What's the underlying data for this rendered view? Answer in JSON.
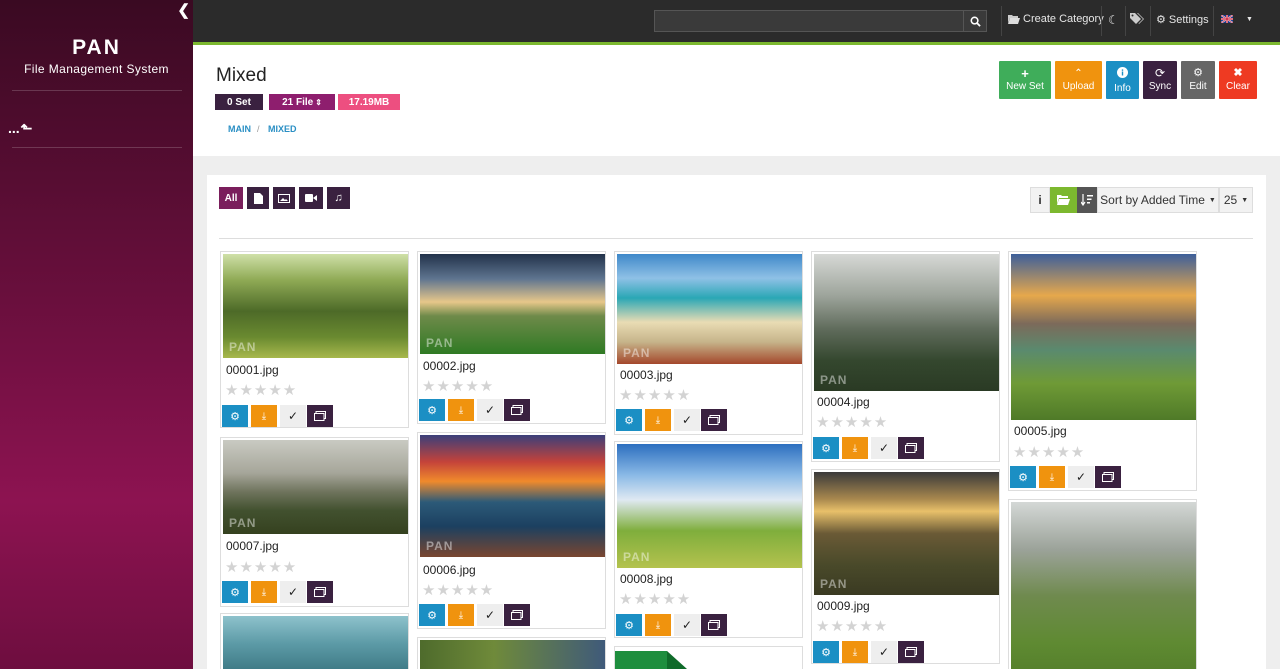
{
  "app": {
    "logo": "PAN",
    "subtitle": "File Management System",
    "up_label": "...",
    "watermark": "PAN"
  },
  "topbar": {
    "search_placeholder": "",
    "create_category": "Create Category",
    "settings": "Settings",
    "theme_icon": "moon-icon",
    "tags_icon": "tags-icon",
    "language_icon": "uk-flag-icon"
  },
  "header": {
    "title": "Mixed",
    "badges": {
      "sets": "0 Set",
      "files": "21 File",
      "size": "17.19MB"
    },
    "breadcrumb": [
      "MAIN",
      "MIXED"
    ],
    "actions": {
      "new_set": "New Set",
      "upload": "Upload",
      "info": "Info",
      "sync": "Sync",
      "edit": "Edit",
      "clear": "Clear"
    }
  },
  "colors": {
    "new_set": "#3fad5a",
    "upload": "#f0930e",
    "info": "#1b8fc4",
    "sync": "#3a2140",
    "edit": "#666666",
    "clear": "#ee3a22",
    "accent": "#7cb82f",
    "badge_sets": "#3a2140",
    "badge_files": "#8e1e6e",
    "badge_size": "#ed4f80"
  },
  "toolbar": {
    "filters": [
      "All",
      "document-icon",
      "image-icon",
      "video-icon",
      "music-icon"
    ],
    "sort_label": "Sort by Added Time",
    "per_page": "25"
  },
  "files": [
    {
      "name": "00001.jpg",
      "rating": 0
    },
    {
      "name": "00002.jpg",
      "rating": 0
    },
    {
      "name": "00003.jpg",
      "rating": 0
    },
    {
      "name": "00004.jpg",
      "rating": 0
    },
    {
      "name": "00005.jpg",
      "rating": 0
    },
    {
      "name": "00007.jpg",
      "rating": 0
    },
    {
      "name": "00006.jpg",
      "rating": 0
    },
    {
      "name": "00008.jpg",
      "rating": 0
    },
    {
      "name": "00009.jpg",
      "rating": 0
    }
  ],
  "card_actions": [
    "gear-icon",
    "pin-icon",
    "check-icon",
    "gallery-icon"
  ]
}
